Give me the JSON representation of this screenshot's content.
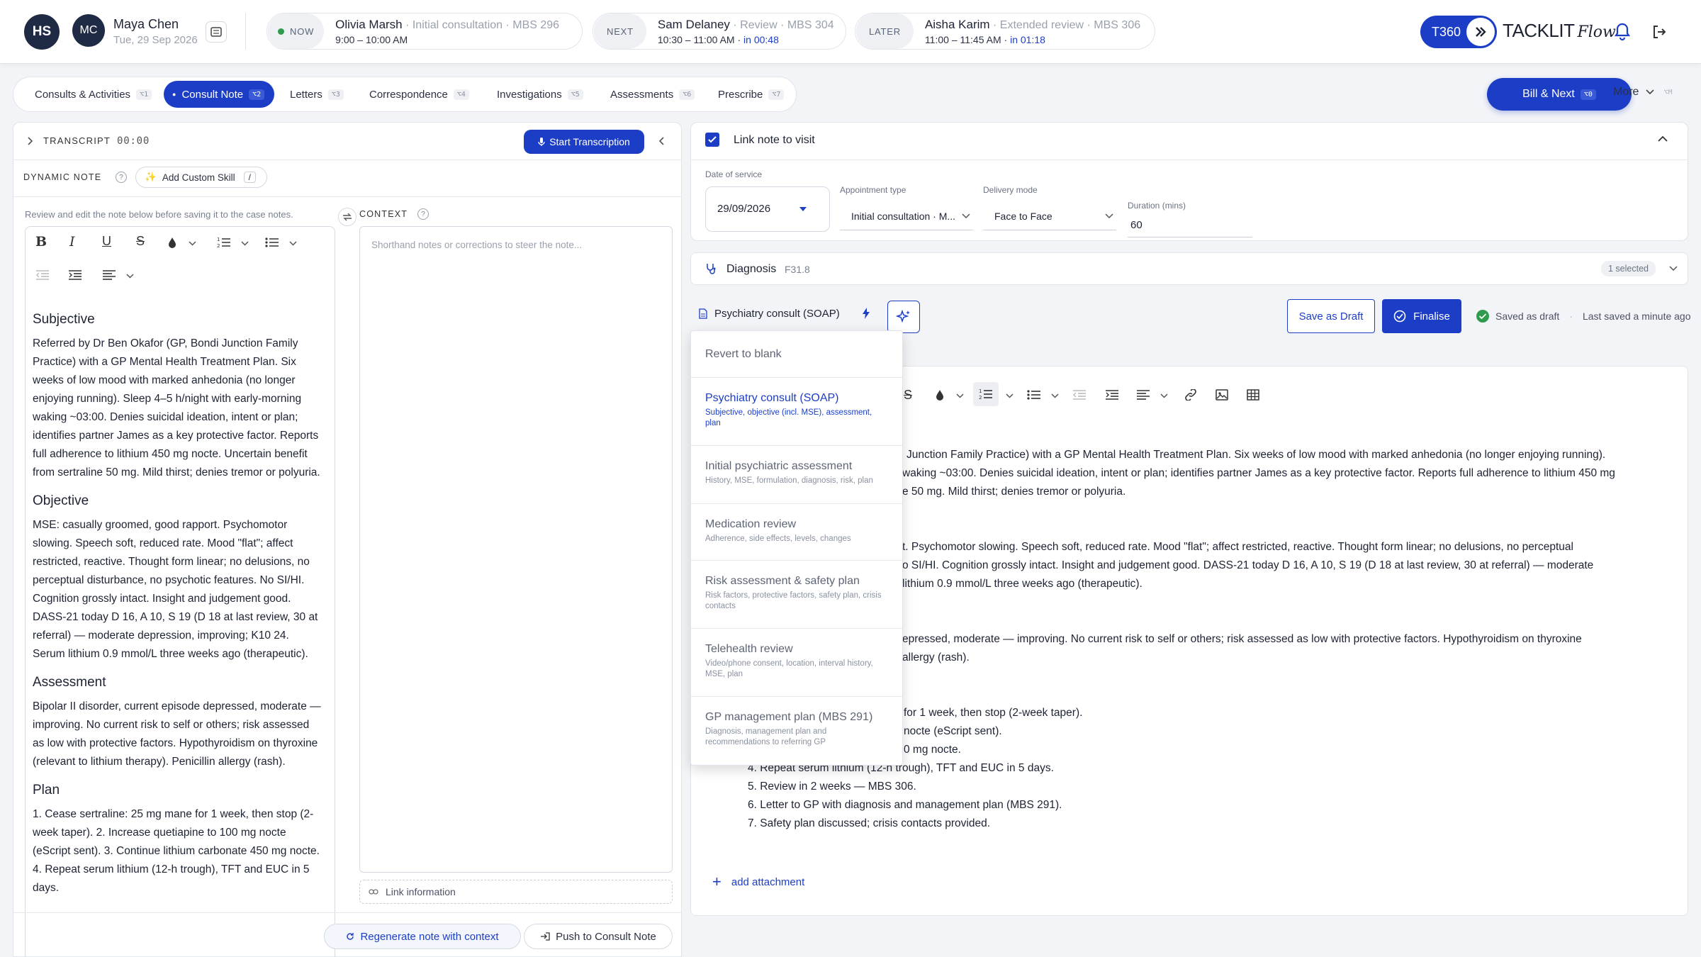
{
  "user": {
    "initials": "HS"
  },
  "patient": {
    "initials": "MC",
    "name": "Maya Chen",
    "date": "Tue, 29 Sep 2026"
  },
  "appointments": {
    "now": {
      "tag": "NOW",
      "name": "Olivia Marsh",
      "desc": "Initial consultation · MBS 296",
      "time": "9:00 – 10:00 AM"
    },
    "next": {
      "tag": "NEXT",
      "name": "Sam Delaney",
      "desc": "Review · MBS 304",
      "time": "10:30 – 11:00 AM",
      "in": "in 00:48"
    },
    "later": {
      "tag": "LATER",
      "name": "Aisha Karim",
      "desc": "Extended review · MBS 306",
      "time": "11:00 – 11:45 AM",
      "in": "in 01:18"
    }
  },
  "brand": {
    "badge": "T360",
    "name": "TACKLIT",
    "script": "Flow"
  },
  "tabs": [
    {
      "label": "Consults & Activities",
      "key": "⌥1"
    },
    {
      "label": "Consult Note",
      "key": "⌥2"
    },
    {
      "label": "Letters",
      "key": "⌥3"
    },
    {
      "label": "Correspondence",
      "key": "⌥4"
    },
    {
      "label": "Investigations",
      "key": "⌥5"
    },
    {
      "label": "Assessments",
      "key": "⌥6"
    },
    {
      "label": "Prescribe",
      "key": "⌥7"
    }
  ],
  "actions": {
    "bill_next": "Bill & Next",
    "bill_key": "⌥0",
    "more": "More",
    "more_key": "⌥M"
  },
  "transcript": {
    "label": "TRANSCRIPT",
    "time": "00:00",
    "start": "Start Transcription"
  },
  "dynamic": {
    "label": "DYNAMIC NOTE",
    "add_skill": "Add Custom Skill",
    "slash": "/",
    "hint": "Review and edit the note below before saving it to the case notes."
  },
  "context": {
    "label": "CONTEXT",
    "placeholder": "Shorthand notes or corrections to steer the note...",
    "link": "Link information"
  },
  "left_note": {
    "subjective_h": "Subjective",
    "subjective": "Referred by Dr Ben Okafor (GP, Bondi Junction Family Practice) with a GP Mental Health Treatment Plan. Six weeks of low mood with marked anhedonia (no longer enjoying running). Sleep 4–5 h/night with early-morning waking ~03:00. Denies suicidal ideation, intent or plan; identifies partner James as a key protective factor. Reports full adherence to lithium 450 mg nocte. Uncertain benefit from sertraline 50 mg. Mild thirst; denies tremor or polyuria.",
    "objective_h": "Objective",
    "objective": "MSE: casually groomed, good rapport. Psychomotor slowing. Speech soft, reduced rate. Mood \"flat\"; affect restricted, reactive. Thought form linear; no delusions, no perceptual disturbance, no psychotic features. No SI/HI. Cognition grossly intact. Insight and judgement good. DASS-21 today D 16, A 10, S 19 (D 18 at last review, 30 at referral) — moderate depression, improving; K10 24. Serum lithium 0.9 mmol/L three weeks ago (therapeutic).",
    "assessment_h": "Assessment",
    "assessment": "Bipolar II disorder, current episode depressed, moderate — improving. No current risk to self or others; risk assessed as low with protective factors. Hypothyroidism on thyroxine (relevant to lithium therapy). Penicillin allergy (rash).",
    "plan_h": "Plan",
    "plan": "1. Cease sertraline: 25 mg mane for 1 week, then stop (2-week taper). 2. Increase quetiapine to 100 mg nocte (eScript sent). 3. Continue lithium carbonate 450 mg nocte. 4. Repeat serum lithium (12-h trough), TFT and EUC in 5 days."
  },
  "bottom": {
    "regenerate": "Regenerate note with context",
    "push": "Push to Consult Note"
  },
  "visit": {
    "link_label": "Link note to visit",
    "date_label": "Date of service",
    "date": "29/09/2026",
    "type_label": "Appointment type",
    "type": "Initial consultation · M...",
    "mode_label": "Delivery mode",
    "mode": "Face to Face",
    "duration_label": "Duration (mins)",
    "duration": "60"
  },
  "diagnosis": {
    "label": "Diagnosis",
    "code": "F31.8",
    "selected": "1 selected"
  },
  "template": {
    "name": "Psychiatry consult (SOAP)",
    "save_draft": "Save as Draft",
    "finalise": "Finalise",
    "saved": "Saved as draft",
    "last_saved": "Last saved a minute ago"
  },
  "menu": {
    "revert": "Revert to blank",
    "items": [
      {
        "title": "Psychiatry consult (SOAP)",
        "sub": "Subjective, objective (incl. MSE), assessment, plan"
      },
      {
        "title": "Initial psychiatric assessment",
        "sub": "History, MSE, formulation, diagnosis, risk, plan"
      },
      {
        "title": "Medication review",
        "sub": "Adherence, side effects, levels, changes"
      },
      {
        "title": "Risk assessment & safety plan",
        "sub": "Risk factors, protective factors, safety plan, crisis contacts"
      },
      {
        "title": "Telehealth review",
        "sub": "Video/phone consent, location, interval history, MSE, plan"
      },
      {
        "title": "GP management plan (MBS 291)",
        "sub": "Diagnosis, management plan and recommendations to referring GP"
      }
    ]
  },
  "editor_lines": [
    "Junction Family Practice) with a GP Mental Health Treatment Plan. Six weeks of low mood with marked anhedonia (no longer enjoying running).",
    "waking ~03:00. Denies suicidal ideation, intent or plan; identifies partner James as a key protective factor. Reports full adherence to lithium 450 mg",
    "e 50 mg. Mild thirst; denies tremor or polyuria.",
    "t. Psychomotor slowing. Speech soft, reduced rate. Mood \"flat\"; affect restricted, reactive. Thought form linear; no delusions, no perceptual",
    "o SI/HI. Cognition grossly intact. Insight and judgement good. DASS-21 today D 16, A 10, S 19 (D 18 at last review, 30 at referral) — moderate",
    "lithium 0.9 mmol/L three weeks ago (therapeutic).",
    "epressed, moderate — improving. No current risk to self or others; risk assessed as low with protective factors. Hypothyroidism on thyroxine",
    "allergy (rash).",
    "for 1 week, then stop (2-week taper).",
    "nocte (eScript sent).",
    "0 mg nocte.",
    "4. Repeat serum lithium (12-h trough), TFT and EUC in 5 days.",
    "5. Review in 2 weeks — MBS 306.",
    "6. Letter to GP with diagnosis and management plan (MBS 291).",
    "7. Safety plan discussed; crisis contacts provided."
  ],
  "attachment": "add attachment",
  "colors": {
    "primary": "#1c3ec7",
    "success": "#2e9b4e",
    "bg": "#f3f4f7"
  }
}
